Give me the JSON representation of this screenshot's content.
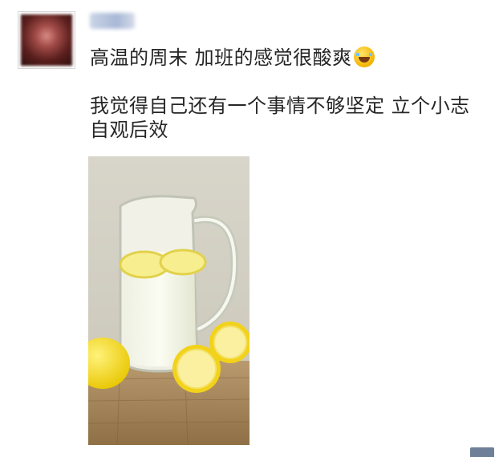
{
  "post": {
    "line1": "高温的周末 加班的感觉很酸爽",
    "line2": "我觉得自己还有一个事情不够坚定 立个小志",
    "line3": "自观后效"
  },
  "icons": {
    "emoji": "laugh-cry-emoji-icon"
  },
  "colors": {
    "text": "#262626",
    "background": "#ffffff"
  }
}
